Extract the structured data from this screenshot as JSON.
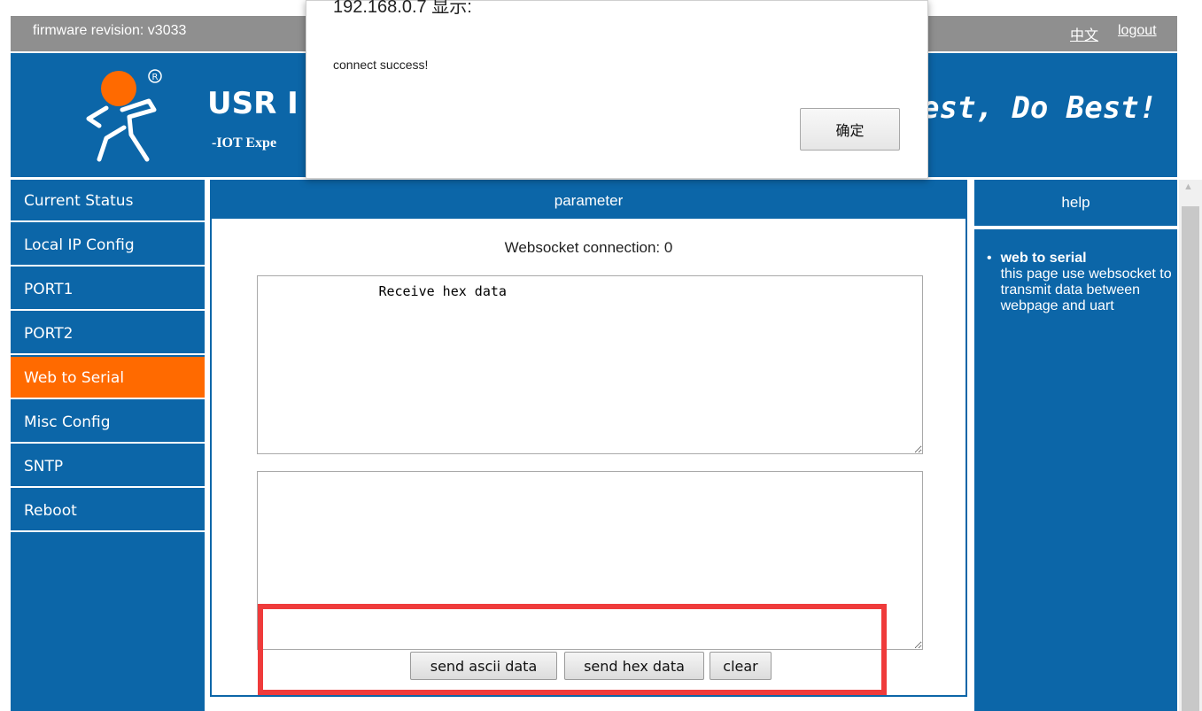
{
  "topbar": {
    "firmware_label": "firmware revision: v3033",
    "lang_link": "中文",
    "logout_link": "logout"
  },
  "banner": {
    "brand_name": "USR I",
    "brand_sub": "-IOT Expe",
    "slogan": "est, Do Best!"
  },
  "sidebar": {
    "items": [
      {
        "label": "Current Status"
      },
      {
        "label": "Local IP Config"
      },
      {
        "label": "PORT1"
      },
      {
        "label": "PORT2"
      },
      {
        "label": "Web to Serial",
        "active": true
      },
      {
        "label": "Misc Config"
      },
      {
        "label": "SNTP"
      },
      {
        "label": "Reboot"
      }
    ]
  },
  "main": {
    "header": "parameter",
    "ws_status": "Websocket connection: 0",
    "receive_text": "              Receive hex data",
    "send_text": "",
    "buttons": {
      "send_ascii": "send ascii data",
      "send_hex": "send hex data",
      "clear": "clear"
    }
  },
  "help": {
    "header": "help",
    "title": "web to serial",
    "body": "this page use websocket to transmit data between webpage and uart"
  },
  "dialog": {
    "title": "192.168.0.7 显示:",
    "message": "connect success!",
    "ok_label": "确定"
  },
  "colors": {
    "brand_blue": "#0c66a8",
    "active_orange": "#ff6a00",
    "topbar_gray": "#8f8f8f",
    "highlight_red": "#ef3b3b"
  }
}
